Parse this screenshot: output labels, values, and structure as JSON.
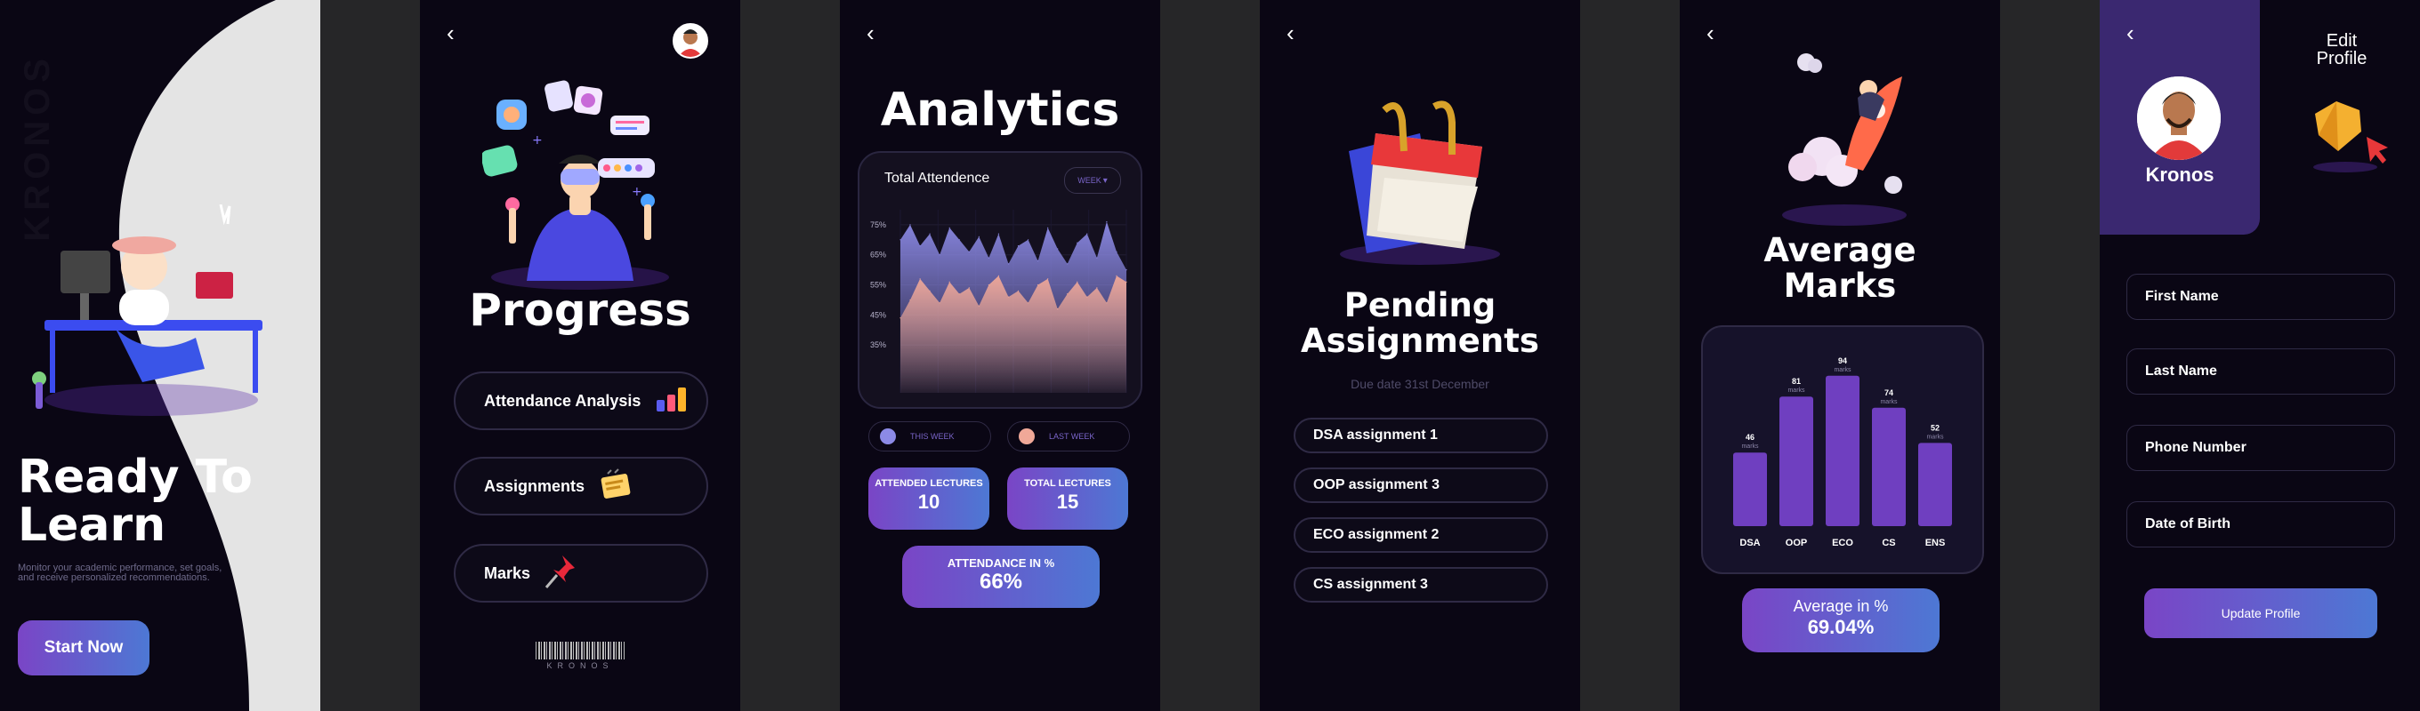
{
  "screen1": {
    "brand_vertical": "KRONOS",
    "headline_line1": "Ready To",
    "headline_line2": "Learn",
    "subtitle": "Monitor your academic performance, set goals, and receive personalized recommendations.",
    "start_button": "Start Now"
  },
  "screen2": {
    "back_icon": "‹",
    "title": "Progress",
    "menu": [
      {
        "label": "Attendance Analysis",
        "icon": "bar-chart-icon"
      },
      {
        "label": "Assignments",
        "icon": "notepad-icon"
      },
      {
        "label": "Marks",
        "icon": "pushpin-icon"
      }
    ],
    "barcode_text": "KRONOS"
  },
  "screen3": {
    "back_icon": "‹",
    "title": "Analytics",
    "card_title": "Total Attendence",
    "period_select": "WEEK",
    "chart_data": {
      "type": "area",
      "title": "Total Attendence",
      "y_ticks": [
        "75%",
        "65%",
        "55%",
        "45%",
        "35%"
      ],
      "ylim": [
        25,
        80
      ],
      "series": [
        {
          "name": "THIS WEEK",
          "color": "#8c8ae6",
          "values": [
            70,
            75,
            68,
            72,
            65,
            74,
            70,
            66,
            71,
            64,
            72,
            62,
            68,
            70,
            63,
            74,
            67,
            62,
            69,
            72,
            64,
            76,
            66,
            60
          ]
        },
        {
          "name": "LAST WEEK",
          "color": "#f0a898",
          "values": [
            44,
            50,
            57,
            53,
            49,
            56,
            52,
            54,
            48,
            55,
            58,
            51,
            53,
            49,
            55,
            57,
            47,
            52,
            56,
            51,
            54,
            49,
            58,
            56
          ]
        }
      ]
    },
    "legend_this_week": "THIS WEEK",
    "legend_last_week": "LAST WEEK",
    "attended_label": "ATTENDED LECTURES",
    "attended_value": "10",
    "total_label": "TOTAL LECTURES",
    "total_value": "15",
    "attendance_pct_label": "ATTENDANCE IN %",
    "attendance_pct_value": "66%"
  },
  "screen4": {
    "back_icon": "‹",
    "title_line1": "Pending",
    "title_line2": "Assignments",
    "due": "Due date 31st December",
    "assignments": [
      "DSA assignment 1",
      "OOP assignment 3",
      "ECO assignment 2",
      "CS assignment 3"
    ]
  },
  "screen5": {
    "back_icon": "‹",
    "title_line1": "Average",
    "title_line2": "Marks",
    "chart_data": {
      "type": "bar",
      "categories": [
        "DSA",
        "OOP",
        "ECO",
        "CS",
        "ENS"
      ],
      "values": [
        46,
        81,
        94,
        74,
        52
      ],
      "value_suffix": "marks",
      "ylim": [
        0,
        100
      ],
      "color": "#6f3fc0"
    },
    "avg_label": "Average in %",
    "avg_value": "69.04%"
  },
  "screen6": {
    "back_icon": "‹",
    "edit_line1": "Edit",
    "edit_line2": "Profile",
    "name": "Kronos",
    "fields": [
      "First Name",
      "Last Name",
      "Phone Number",
      "Date of Birth"
    ],
    "update_button": "Update Profile"
  }
}
